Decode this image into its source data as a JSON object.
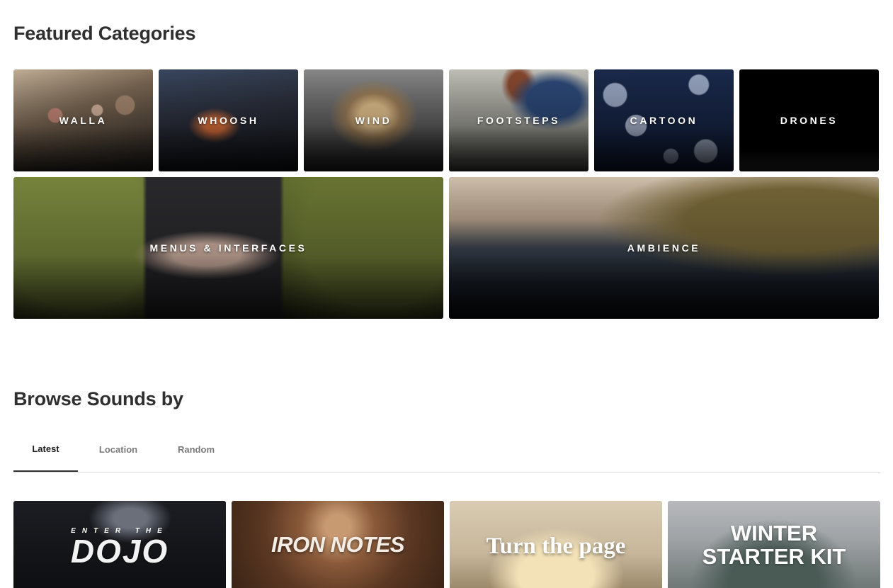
{
  "featured": {
    "title": "Featured Categories",
    "categories": [
      {
        "label": "WALLA"
      },
      {
        "label": "WHOOSH"
      },
      {
        "label": "WIND"
      },
      {
        "label": "FOOTSTEPS"
      },
      {
        "label": "CARTOON"
      },
      {
        "label": "DRONES"
      },
      {
        "label": "MENUS & INTERFACES"
      },
      {
        "label": "AMBIENCE"
      }
    ]
  },
  "browse": {
    "title": "Browse Sounds by",
    "tabs": [
      {
        "label": "Latest",
        "active": true
      },
      {
        "label": "Location",
        "active": false
      },
      {
        "label": "Random",
        "active": false
      }
    ],
    "cards": [
      {
        "small": "ENTER THE",
        "big": "DOJO"
      },
      {
        "title": "IRON NOTES"
      },
      {
        "title": "Turn the page"
      },
      {
        "line1": "WINTER",
        "line2": "STARTER KIT"
      }
    ]
  }
}
